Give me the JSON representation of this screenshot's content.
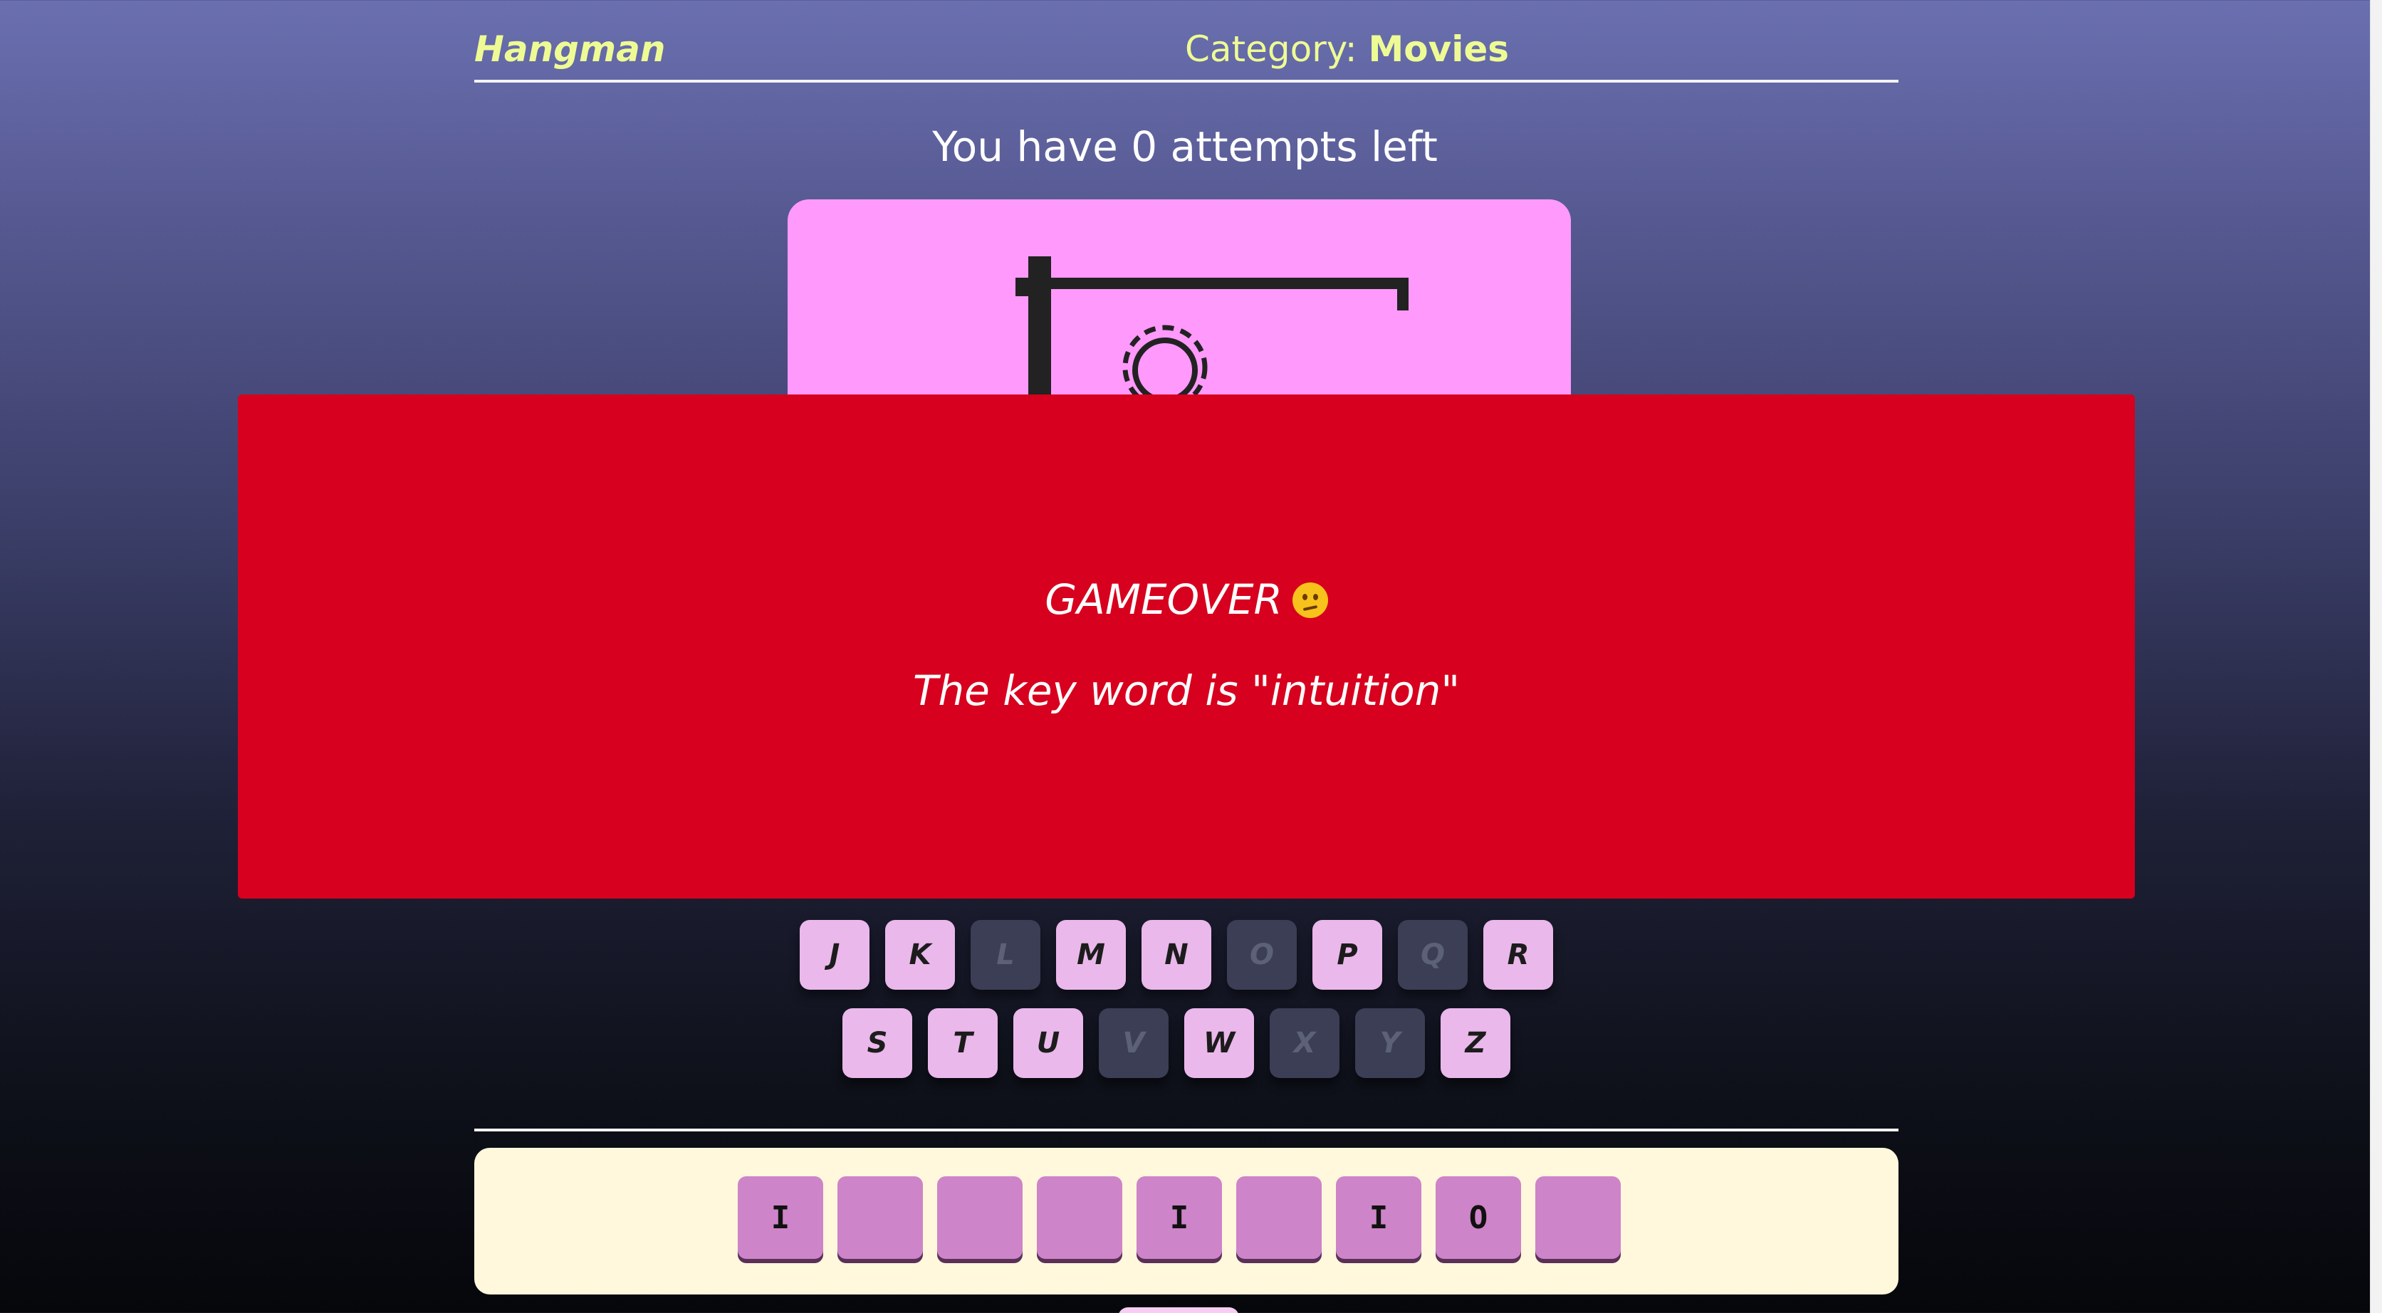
{
  "header": {
    "brand": "Hangman",
    "category_label": "Category:",
    "category_value": "Movies"
  },
  "status": {
    "attempts_text": "You have 0 attempts left"
  },
  "keyboard": {
    "row2": [
      {
        "letter": "J",
        "used": false
      },
      {
        "letter": "K",
        "used": false
      },
      {
        "letter": "L",
        "used": true
      },
      {
        "letter": "M",
        "used": false
      },
      {
        "letter": "N",
        "used": false
      },
      {
        "letter": "O",
        "used": true
      },
      {
        "letter": "P",
        "used": false
      },
      {
        "letter": "Q",
        "used": true
      },
      {
        "letter": "R",
        "used": false
      }
    ],
    "row3": [
      {
        "letter": "S",
        "used": false
      },
      {
        "letter": "T",
        "used": false
      },
      {
        "letter": "U",
        "used": false
      },
      {
        "letter": "V",
        "used": true
      },
      {
        "letter": "W",
        "used": false
      },
      {
        "letter": "X",
        "used": true
      },
      {
        "letter": "Y",
        "used": true
      },
      {
        "letter": "Z",
        "used": false
      }
    ]
  },
  "word": {
    "tiles": [
      "I",
      "",
      "",
      "",
      "I",
      "",
      "I",
      "O",
      ""
    ]
  },
  "overlay": {
    "title": "GAMEOVER",
    "emoji": "confused-face",
    "message": "The key word is \"intuition\""
  },
  "colors": {
    "accent": "#eefb94",
    "overlay": "#d7001e",
    "card": "#ff99fb",
    "key": "#eab8eb",
    "key_used": "#3b3e55",
    "tile": "#cd84c8",
    "word_panel": "#fff8dc"
  }
}
